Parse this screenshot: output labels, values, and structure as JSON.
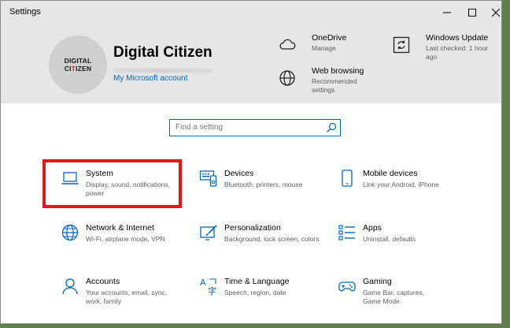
{
  "window": {
    "title": "Settings"
  },
  "account": {
    "avatar_line1": "DIGITAL",
    "avatar_line2_prefix": "CI",
    "avatar_line2_accent": "T",
    "avatar_line2_suffix": "IZEN",
    "name": "Digital Citizen",
    "link": "My Microsoft account"
  },
  "header_items": [
    {
      "title": "OneDrive",
      "sub": "Manage",
      "icon": "cloud-icon"
    },
    {
      "title": "Web browsing",
      "sub": "Recommended settings",
      "icon": "globe-icon"
    },
    {
      "title": "Windows Update",
      "sub": "Last checked: 1 hour ago",
      "icon": "refresh-icon"
    }
  ],
  "search": {
    "placeholder": "Find a setting"
  },
  "tiles": [
    {
      "name": "System",
      "desc": "Display, sound, notifications, power",
      "icon": "laptop-icon"
    },
    {
      "name": "Devices",
      "desc": "Bluetooth, printers, mouse",
      "icon": "devices-icon"
    },
    {
      "name": "Mobile devices",
      "desc": "Link your Android, iPhone",
      "icon": "phone-icon"
    },
    {
      "name": "Network & Internet",
      "desc": "Wi-Fi, airplane mode, VPN",
      "icon": "globe-icon"
    },
    {
      "name": "Personalization",
      "desc": "Background, lock screen, colors",
      "icon": "paintbrush-icon"
    },
    {
      "name": "Apps",
      "desc": "Uninstall, defaults",
      "icon": "list-icon"
    },
    {
      "name": "Accounts",
      "desc": "Your accounts, email, sync, work, family",
      "icon": "person-icon"
    },
    {
      "name": "Time & Language",
      "desc": "Speech, region, date",
      "icon": "language-icon"
    },
    {
      "name": "Gaming",
      "desc": "Game Bar, captures, Game Mode",
      "icon": "gamepad-icon"
    }
  ],
  "colors": {
    "accent": "#0067c0",
    "highlight": "#e8141b",
    "header_bg": "#e6e6e6"
  }
}
